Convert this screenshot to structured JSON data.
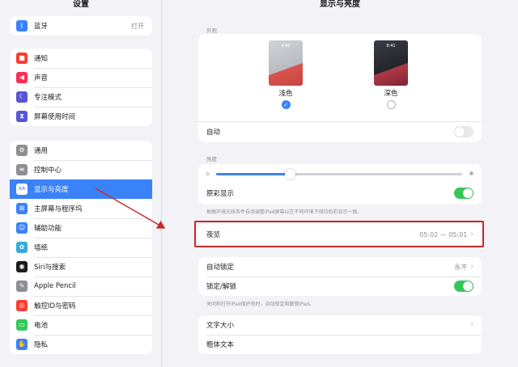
{
  "sidebar": {
    "title": "设置",
    "bluetooth": {
      "label": "蓝牙",
      "value": "打开",
      "icon": "bluetooth-icon"
    },
    "group2": [
      {
        "label": "通知",
        "icon": "bell-icon",
        "color": "#ff3b30",
        "glyph": "■"
      },
      {
        "label": "声音",
        "icon": "speaker-icon",
        "color": "#ff2d55",
        "glyph": "◀"
      },
      {
        "label": "专注模式",
        "icon": "moon-icon",
        "color": "#5856d6",
        "glyph": "☾"
      },
      {
        "label": "屏幕使用时间",
        "icon": "hourglass-icon",
        "color": "#5856d6",
        "glyph": "⧗"
      }
    ],
    "group3": [
      {
        "label": "通用",
        "icon": "gear-icon",
        "color": "#8e8e93",
        "glyph": "⚙"
      },
      {
        "label": "控制中心",
        "icon": "switches-icon",
        "color": "#8e8e93",
        "glyph": "≡"
      },
      {
        "label": "显示与亮度",
        "icon": "display-icon",
        "color": "#3a82f7",
        "glyph": "AA"
      },
      {
        "label": "主屏幕与程序坞",
        "icon": "home-grid-icon",
        "color": "#3a82f7",
        "glyph": "⊞"
      },
      {
        "label": "辅助功能",
        "icon": "accessibility-icon",
        "color": "#3a82f7",
        "glyph": "☺"
      },
      {
        "label": "墙纸",
        "icon": "wallpaper-icon",
        "color": "#34aadc",
        "glyph": "✿"
      },
      {
        "label": "Siri与搜索",
        "icon": "siri-icon",
        "color": "#1c1c1e",
        "glyph": "◉"
      },
      {
        "label": "Apple Pencil",
        "icon": "pencil-icon",
        "color": "#8e8e93",
        "glyph": "✎"
      },
      {
        "label": "触控ID与密码",
        "icon": "fingerprint-icon",
        "color": "#ff3b30",
        "glyph": "◎"
      },
      {
        "label": "电池",
        "icon": "battery-icon",
        "color": "#34c759",
        "glyph": "▭"
      },
      {
        "label": "隐私",
        "icon": "hand-icon",
        "color": "#3a82f7",
        "glyph": "✋"
      }
    ]
  },
  "main": {
    "title": "显示与亮度",
    "appearance": {
      "section_label": "外观",
      "light": {
        "label": "浅色",
        "time": "9:41",
        "selected": true
      },
      "dark": {
        "label": "深色",
        "time": "9:41",
        "selected": false
      },
      "auto_label": "自动",
      "auto_on": false
    },
    "brightness": {
      "section_label": "亮度",
      "level": 0.3,
      "true_tone_label": "原彩显示",
      "true_tone_on": true,
      "true_tone_note": "根据环境光线条件自动调整iPad屏幕以在不同环境下保持色彩显示一致。"
    },
    "night_shift": {
      "label": "夜览",
      "value": "05:02 — 05:01"
    },
    "auto_lock": {
      "label": "自动锁定",
      "value": "永不"
    },
    "lock_unlock": {
      "label": "锁定/解锁",
      "on": true,
      "note": "关闭和打开iPad保护壳时，自动锁定和解锁iPad。"
    },
    "text_size_label": "文字大小",
    "bold_text_label": "粗体文本"
  },
  "colors": {
    "accent": "#3a82f7",
    "toggle_on": "#34c759",
    "annotation": "#c62828"
  }
}
